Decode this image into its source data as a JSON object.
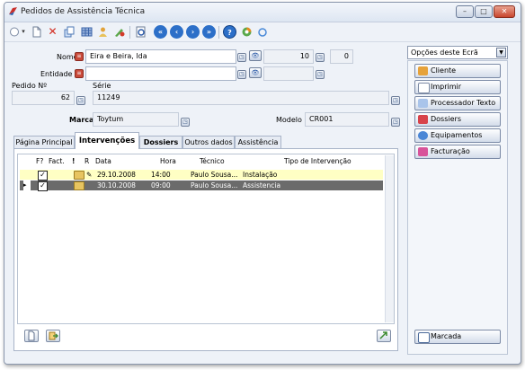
{
  "window": {
    "title": "Pedidos de Assistência Técnica",
    "min_label": "–",
    "max_label": "□",
    "close_label": "✕"
  },
  "toolbar": {
    "icons": [
      "new-icon",
      "delete-icon",
      "copy-icon",
      "grid-icon",
      "user-icon",
      "edit-icon",
      "preview-icon",
      "first-icon",
      "previous-icon",
      "next-icon",
      "last-icon",
      "help-icon",
      "refresh-icon"
    ],
    "nav": {
      "first": "«",
      "previous": "‹",
      "next": "›",
      "last": "»",
      "help": "?"
    }
  },
  "form": {
    "nome_label": "Nome",
    "nome_value": "Eira e Beira, lda",
    "nome_code": "10",
    "nome_extra": "0",
    "entidade_label": "Entidade",
    "entidade_value": "",
    "pedido_label": "Pedido Nº",
    "pedido_value": "62",
    "serie_label": "Série",
    "serie_value": "11249",
    "marca_label": "Marca",
    "marca_value": "Toytum",
    "modelo_label": "Modelo",
    "modelo_value": "CR001"
  },
  "tabs": [
    {
      "label": "Página Principal",
      "active": false
    },
    {
      "label": "Intervenções",
      "active": true
    },
    {
      "label": "Dossiers",
      "active": false
    },
    {
      "label": "Outros dados",
      "active": false
    },
    {
      "label": "Assistência",
      "active": false
    }
  ],
  "grid": {
    "columns": {
      "f": "F?",
      "fact": "Fact.",
      "flag": "!",
      "r": "R",
      "data": "Data",
      "hora": "Hora",
      "tecnico": "Técnico",
      "tipo": "Tipo de Intervenção"
    },
    "rows": [
      {
        "data": "29.10.2008",
        "hora": "14:00",
        "tecnico": "Paulo Sousa...",
        "tipo": "Instalação",
        "checked": true,
        "bg": "#ffffc4"
      },
      {
        "data": "30.10.2008",
        "hora": "09:00",
        "tecnico": "Paulo Sousa...",
        "tipo": "Assistencia",
        "checked": true,
        "bg": "#6b6b6b",
        "selected": true
      }
    ]
  },
  "side": {
    "options_label": "Opções deste Ecrã",
    "buttons": [
      "Cliente",
      "Imprimir",
      "Processador Texto",
      "Dossiers",
      "Equipamentos",
      "Facturação"
    ],
    "marcada_label": "Marcada"
  },
  "colors": {
    "accent": "#2c6fc8",
    "selected_row": "#6b6b6b",
    "highlight_row": "#ffffc4"
  }
}
